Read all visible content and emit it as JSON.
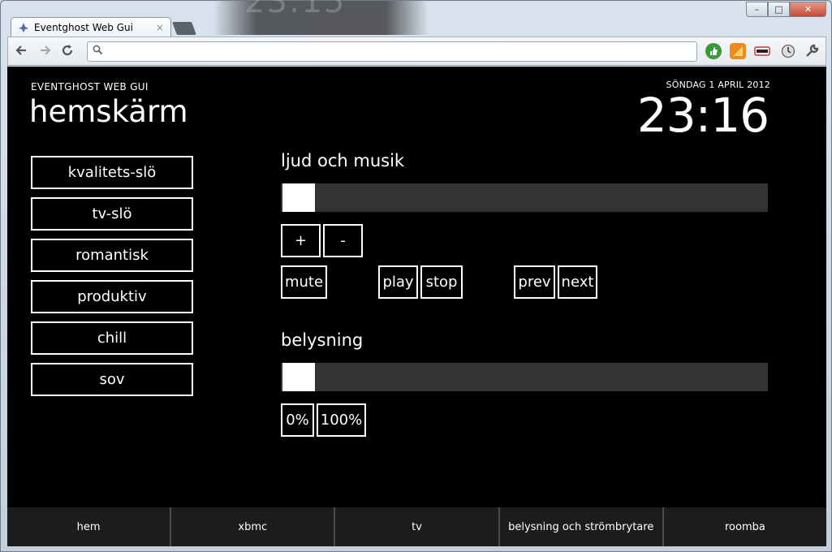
{
  "browser": {
    "tab_title": "Eventghost Web Gui",
    "tab_close": "×",
    "address": "",
    "icons": [
      "back-arrow-icon",
      "forward-arrow-icon",
      "reload-icon",
      "search-icon",
      "thumbs-up-icon",
      "rss-feed-icon",
      "disguise-mask-icon",
      "clock-icon",
      "wrench-icon"
    ],
    "window_controls": {
      "minimize": "–",
      "maximize": "□",
      "close": "✕"
    },
    "background_clock": "23:15"
  },
  "header": {
    "app_name": "EVENTGHOST WEB GUI",
    "page_title": "hemskärm",
    "date": "SÖNDAG 1 APRIL 2012",
    "time": "23:16"
  },
  "scenes": [
    {
      "label": "kvalitets-slö"
    },
    {
      "label": "tv-slö"
    },
    {
      "label": "romantisk"
    },
    {
      "label": "produktiv"
    },
    {
      "label": "chill"
    },
    {
      "label": "sov"
    }
  ],
  "audio": {
    "title": "ljud och musik",
    "volume_fraction": 0.07,
    "buttons": {
      "plus": "+",
      "minus": "-",
      "mute": "mute",
      "play": "play",
      "stop": "stop",
      "prev": "prev",
      "next": "next"
    }
  },
  "lighting": {
    "title": "belysning",
    "level_fraction": 0.07,
    "buttons": {
      "off": "0%",
      "full": "100%"
    }
  },
  "bottom_nav": [
    {
      "label": "hem"
    },
    {
      "label": "xbmc"
    },
    {
      "label": "tv"
    },
    {
      "label": "belysning och strömbrytare"
    },
    {
      "label": "roomba"
    }
  ],
  "colors": {
    "page_background": "#000000",
    "slider_track": "#333333",
    "slider_thumb": "#ffffff",
    "nav_background": "#1c1c1c"
  }
}
